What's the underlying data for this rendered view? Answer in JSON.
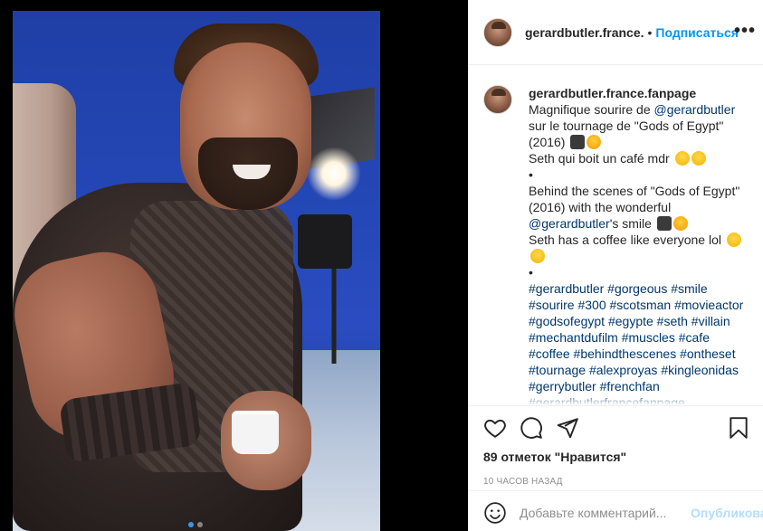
{
  "post": {
    "account": "gerardbutler.france.",
    "follow_label": "Подписаться",
    "more_icon": "more-options-icon",
    "separator": "•"
  },
  "caption": {
    "user": "gerardbutler.france.fanpage",
    "lines": [
      {
        "parts": [
          {
            "t": "Magnifique sourire de "
          },
          {
            "t": "@gerardbutler",
            "k": "mention"
          }
        ]
      },
      {
        "parts": [
          {
            "t": "sur le tournage de \"Gods of Egypt\""
          }
        ]
      },
      {
        "parts": [
          {
            "t": "(2016) "
          },
          {
            "e": "camera"
          },
          {
            "e": "star"
          }
        ]
      },
      {
        "parts": [
          {
            "t": "Seth qui boit un café mdr "
          },
          {
            "e": "laugh"
          },
          {
            "e": "laugh"
          }
        ]
      },
      {
        "parts": [
          {
            "t": "•"
          }
        ]
      },
      {
        "parts": [
          {
            "t": "Behind the scenes of \"Gods of Egypt\""
          }
        ]
      },
      {
        "parts": [
          {
            "t": "(2016) with the wonderful"
          }
        ]
      },
      {
        "parts": [
          {
            "t": "@gerardbutler",
            "k": "mention"
          },
          {
            "t": "'s smile "
          },
          {
            "e": "camera"
          },
          {
            "e": "star"
          }
        ]
      },
      {
        "parts": [
          {
            "t": "Seth has a coffee like everyone lol "
          },
          {
            "e": "laugh"
          }
        ]
      },
      {
        "parts": [
          {
            "e": "laugh"
          }
        ]
      },
      {
        "parts": [
          {
            "t": "•"
          }
        ]
      },
      {
        "parts": [
          {
            "t": "#gerardbutler #gorgeous #smile",
            "k": "hashtag"
          }
        ]
      },
      {
        "parts": [
          {
            "t": "#sourire #300 #scotsman #movieactor",
            "k": "hashtag"
          }
        ]
      },
      {
        "parts": [
          {
            "t": "#godsofegypt #egypte #seth #villain",
            "k": "hashtag"
          }
        ]
      },
      {
        "parts": [
          {
            "t": "#mechantdufilm #muscles #cafe",
            "k": "hashtag"
          }
        ]
      },
      {
        "parts": [
          {
            "t": "#coffee #behindthescenes #ontheset",
            "k": "hashtag"
          }
        ]
      },
      {
        "parts": [
          {
            "t": "#tournage #alexproyas #kingleonidas",
            "k": "hashtag"
          }
        ]
      },
      {
        "parts": [
          {
            "t": "#gerrybutler #frenchfan",
            "k": "hashtag"
          }
        ]
      },
      {
        "parts": [
          {
            "t": "#gerardbutlerfrancefanpage",
            "k": "hashtag"
          }
        ]
      }
    ]
  },
  "actions": {
    "like_icon": "heart-icon",
    "comment_icon": "comment-icon",
    "share_icon": "share-icon",
    "save_icon": "bookmark-icon",
    "likes_text": "89 отметок \"Нравится\"",
    "timestamp": "10 часов назад"
  },
  "comment_box": {
    "emoji_icon": "smiley-icon",
    "placeholder": "Добавьте комментарий...",
    "publish_label": "Опубликовать"
  },
  "carousel": {
    "count": 2,
    "active_index": 0
  },
  "colors": {
    "accent": "#0095f6",
    "link": "#00376b",
    "muted": "#8e8e8e",
    "publish_disabled": "#b2dffc",
    "carousel_active": "#3897f0"
  }
}
